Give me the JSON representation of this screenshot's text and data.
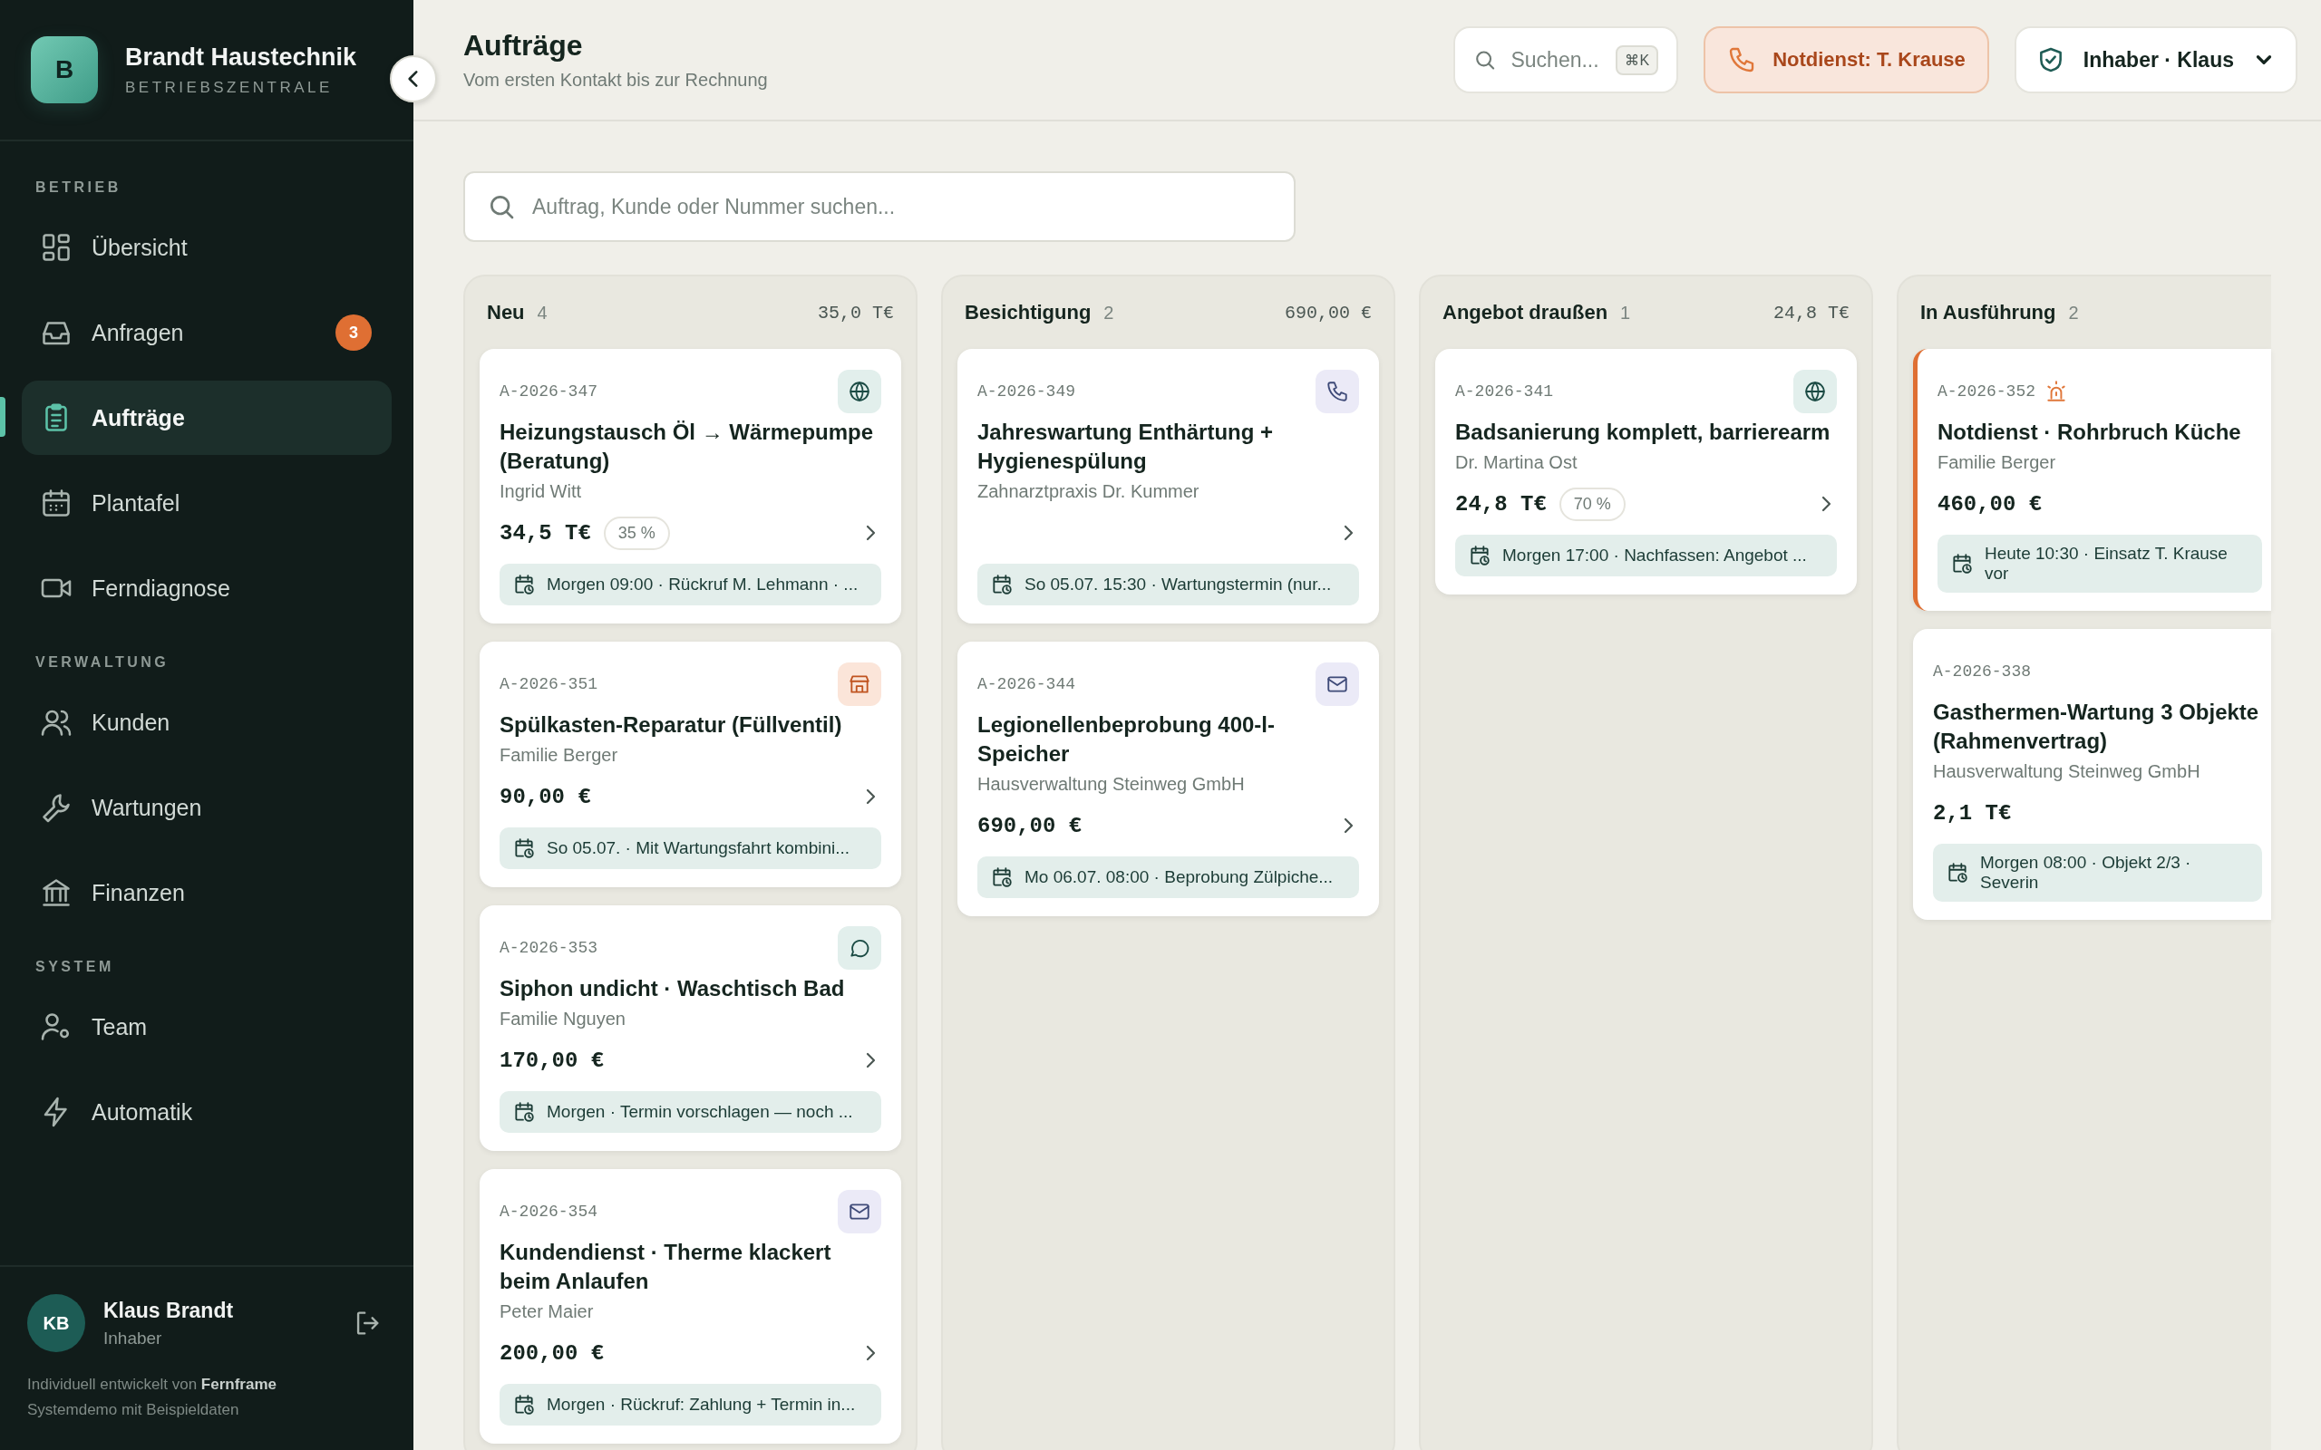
{
  "brand": {
    "initial": "B",
    "name": "Brandt Haustechnik",
    "subtitle": "BETRIEBSZENTRALE"
  },
  "sidebar": {
    "sections": [
      {
        "title": "BETRIEB",
        "items": [
          {
            "label": "Übersicht",
            "selected": false
          },
          {
            "label": "Anfragen",
            "selected": false,
            "badge": "3"
          },
          {
            "label": "Aufträge",
            "selected": true
          },
          {
            "label": "Plantafel",
            "selected": false
          },
          {
            "label": "Ferndiagnose",
            "selected": false
          }
        ]
      },
      {
        "title": "VERWALTUNG",
        "items": [
          {
            "label": "Kunden",
            "selected": false
          },
          {
            "label": "Wartungen",
            "selected": false
          },
          {
            "label": "Finanzen",
            "selected": false
          }
        ]
      },
      {
        "title": "SYSTEM",
        "items": [
          {
            "label": "Team",
            "selected": false
          },
          {
            "label": "Automatik",
            "selected": false
          }
        ]
      }
    ],
    "user": {
      "initials": "KB",
      "name": "Klaus Brandt",
      "role": "Inhaber"
    },
    "credit": "Individuell entwickelt von **Fernframe**",
    "note": "Systemdemo mit Beispieldaten"
  },
  "header": {
    "title": "Aufträge",
    "subtitle": "Vom ersten Kontakt bis zur Rechnung",
    "search": {
      "placeholder": "Suchen...",
      "shortcut": "⌘K"
    },
    "emergency": "Notdienst: T. Krause",
    "role_menu": "Inhaber · Klaus"
  },
  "board_search": {
    "placeholder": "Auftrag, Kunde oder Nummer suchen..."
  },
  "columns": [
    {
      "title": "Neu",
      "count": "4",
      "total": "35,0 T€",
      "cards": [
        {
          "id": "A-2026-347",
          "kind": "web",
          "urgent": false,
          "title": "Heizungstausch Öl → Wärmepumpe (Beratung)",
          "customer": "Ingrid Witt",
          "amount": "34,5 T€",
          "probability": "35 %",
          "note": "Morgen 09:00 · Rückruf M. Lehmann · ..."
        },
        {
          "id": "A-2026-351",
          "kind": "shop",
          "urgent": false,
          "title": "Spülkasten-Reparatur (Füllventil)",
          "customer": "Familie Berger",
          "amount": "90,00 €",
          "note": "So 05.07. · Mit Wartungsfahrt kombini..."
        },
        {
          "id": "A-2026-353",
          "kind": "chat",
          "urgent": false,
          "title": "Siphon undicht · Waschtisch Bad",
          "customer": "Familie Nguyen",
          "amount": "170,00 €",
          "note": "Morgen · Termin vorschlagen — noch ..."
        },
        {
          "id": "A-2026-354",
          "kind": "mail",
          "urgent": false,
          "title": "Kundendienst · Therme klackert beim Anlaufen",
          "customer": "Peter Maier",
          "amount": "200,00 €",
          "note": "Morgen · Rückruf: Zahlung + Termin in..."
        }
      ]
    },
    {
      "title": "Besichtigung",
      "count": "2",
      "total": "690,00 €",
      "cards": [
        {
          "id": "A-2026-349",
          "kind": "phone",
          "urgent": false,
          "title": "Jahreswartung Enthärtung + Hygienespülung",
          "customer": "Zahnarztpraxis Dr. Kummer",
          "note": "So 05.07. 15:30 · Wartungstermin (nur..."
        },
        {
          "id": "A-2026-344",
          "kind": "mail",
          "urgent": false,
          "title": "Legionellenbeprobung 400-l-Speicher",
          "customer": "Hausverwaltung Steinweg GmbH",
          "amount": "690,00 €",
          "note": "Mo 06.07. 08:00 · Beprobung Zülpiche..."
        }
      ]
    },
    {
      "title": "Angebot draußen",
      "count": "1",
      "total": "24,8 T€",
      "cards": [
        {
          "id": "A-2026-341",
          "kind": "web",
          "urgent": false,
          "title": "Badsanierung komplett, barrierearm",
          "customer": "Dr. Martina Ost",
          "amount": "24,8 T€",
          "probability": "70 %",
          "note": "Morgen 17:00 · Nachfassen: Angebot ..."
        }
      ]
    },
    {
      "title": "In Ausführung",
      "count": "2",
      "cards": [
        {
          "id": "A-2026-352",
          "urgent": true,
          "title": "Notdienst · Rohrbruch Küche",
          "customer": "Familie Berger",
          "amount": "460,00 €",
          "note": "Heute 10:30 · Einsatz T. Krause vor"
        },
        {
          "id": "A-2026-338",
          "urgent": false,
          "title": "Gasthermen-Wartung 3 Objekte (Rahmenvertrag)",
          "customer": "Hausverwaltung Steinweg GmbH",
          "amount": "2,1 T€",
          "note": "Morgen 08:00 · Objekt 2/3 · Severin"
        }
      ]
    }
  ]
}
